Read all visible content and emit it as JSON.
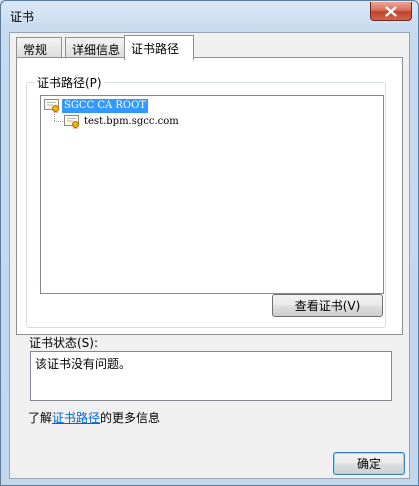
{
  "window": {
    "title": "证书"
  },
  "tabs": [
    {
      "label": "常规"
    },
    {
      "label": "详细信息"
    },
    {
      "label": "证书路径"
    }
  ],
  "cert_path": {
    "group_label": "证书路径(P)",
    "nodes": [
      {
        "label": "SGCC CA ROOT",
        "selected": true
      },
      {
        "label": "test.bpm.sgcc.com",
        "selected": false
      }
    ],
    "view_button": "查看证书(V)"
  },
  "status": {
    "label": "证书状态(S):",
    "text": "该证书没有问题。"
  },
  "info": {
    "prefix": "了解",
    "link": "证书路径",
    "suffix": "的更多信息"
  },
  "footer": {
    "ok_button": "确定"
  },
  "colors": {
    "selection": "#3399ff",
    "link": "#0066cc",
    "close_button": "#c2442b"
  }
}
